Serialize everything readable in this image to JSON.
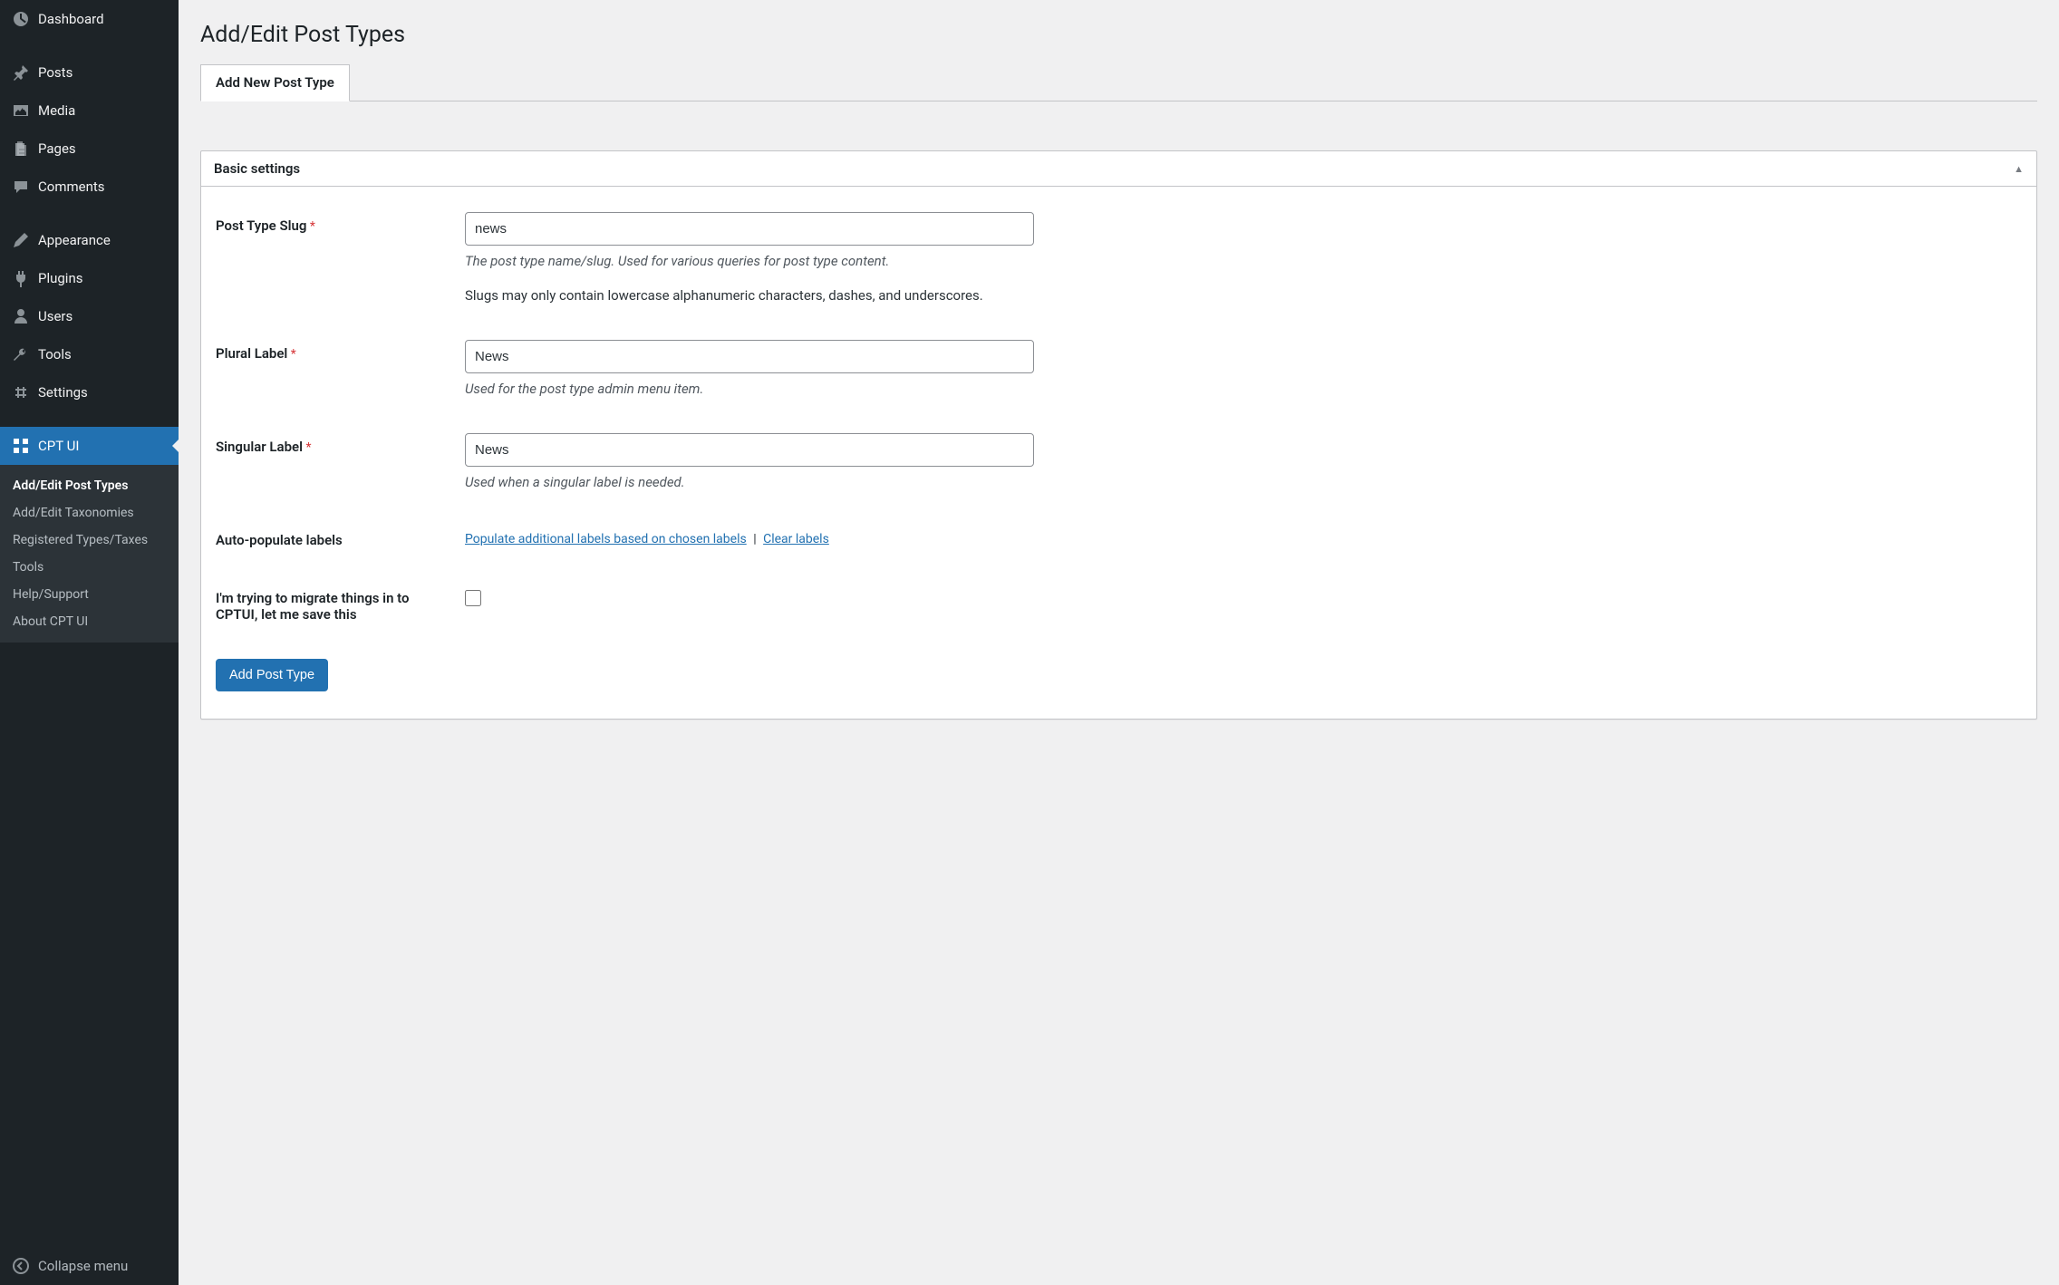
{
  "sidebar": {
    "items": [
      {
        "label": "Dashboard"
      },
      {
        "label": "Posts"
      },
      {
        "label": "Media"
      },
      {
        "label": "Pages"
      },
      {
        "label": "Comments"
      },
      {
        "label": "Appearance"
      },
      {
        "label": "Plugins"
      },
      {
        "label": "Users"
      },
      {
        "label": "Tools"
      },
      {
        "label": "Settings"
      },
      {
        "label": "CPT UI"
      }
    ],
    "submenu": [
      {
        "label": "Add/Edit Post Types"
      },
      {
        "label": "Add/Edit Taxonomies"
      },
      {
        "label": "Registered Types/Taxes"
      },
      {
        "label": "Tools"
      },
      {
        "label": "Help/Support"
      },
      {
        "label": "About CPT UI"
      }
    ],
    "collapse": "Collapse menu"
  },
  "page": {
    "title": "Add/Edit Post Types",
    "tab_active": "Add New Post Type"
  },
  "panel": {
    "heading": "Basic settings",
    "slug": {
      "label": "Post Type Slug",
      "value": "news",
      "desc": "The post type name/slug. Used for various queries for post type content.",
      "note": "Slugs may only contain lowercase alphanumeric characters, dashes, and underscores."
    },
    "plural": {
      "label": "Plural Label",
      "value": "News",
      "desc": "Used for the post type admin menu item."
    },
    "singular": {
      "label": "Singular Label",
      "value": "News",
      "desc": "Used when a singular label is needed."
    },
    "autopop": {
      "label": "Auto-populate labels",
      "populate": "Populate additional labels based on chosen labels",
      "sep": "|",
      "clear": "Clear labels"
    },
    "migrate": {
      "label": "I'm trying to migrate things in to CPTUI, let me save this"
    },
    "submit": "Add Post Type"
  }
}
